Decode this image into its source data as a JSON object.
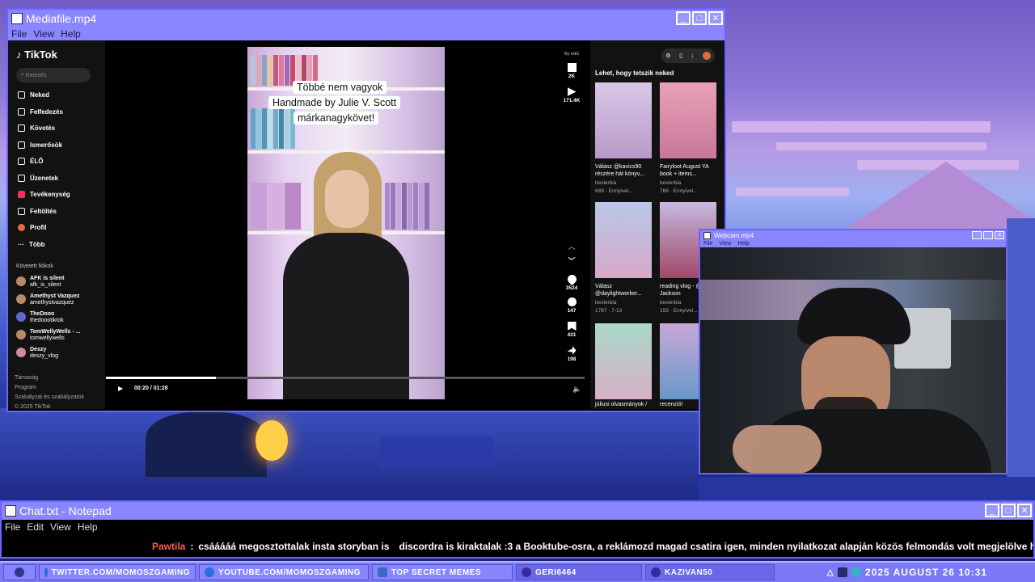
{
  "media_window": {
    "title": "Mediafile.mp4",
    "menu": [
      "File",
      "View",
      "Help"
    ]
  },
  "tiktok": {
    "logo": "TikTok",
    "search_placeholder": "Keresés",
    "nav": [
      "Neked",
      "Felfedezés",
      "Követés",
      "Ismerősök",
      "ÉLŐ",
      "Üzenetek",
      "Tevékenység",
      "Feltöltés",
      "Profil",
      "Több"
    ],
    "followed_heading": "Követett fiókok",
    "followed": [
      {
        "name": "AFK is silent",
        "handle": "afk_is_silent"
      },
      {
        "name": "Amethyst Vazquez",
        "handle": "amethystvazquez"
      },
      {
        "name": "TheDooo",
        "handle": "thedoootiktok"
      },
      {
        "name": "TomWellyWells - ...",
        "handle": "tomwellywells"
      },
      {
        "name": "Deszy",
        "handle": "deszy_vlog"
      }
    ],
    "footer": [
      "Társaság",
      "Program",
      "Szabályzat és szabályzatok",
      "© 2025 TikTok"
    ],
    "caption_lines": [
      "Többé nem vagyok",
      "Handmade by Julie V. Scott",
      "márkanagykövet!"
    ],
    "time": "00:20 / 01:28",
    "progress": 0.23,
    "byline": "By ridG",
    "stats": {
      "a": "2K",
      "b": "171.4K",
      "likes": "3524",
      "comments": "147",
      "saves": "431",
      "shares": "198"
    },
    "recs_heading": "Lehet, hogy tetszik neked",
    "recs": [
      {
        "title": "Válasz @kavics90 részére hát könyv,...",
        "author": "bexlerbia",
        "stats": "669 · Ennyivel..."
      },
      {
        "title": "Fairyloot August YA book + items...",
        "author": "bexlerbia",
        "stats": "768 · Ennyivel..."
      },
      {
        "title": "Válasz @daylightworker...",
        "author": "bexlerbia",
        "stats": "1787 · 7-13"
      },
      {
        "title": "reading vlog - @Holly Jackson",
        "author": "bexlerbia",
        "stats": "159 · Ennyivel..."
      },
      {
        "title": "júliusi olvasmányok /",
        "author": "",
        "stats": ""
      },
      {
        "title": "recenzió!",
        "author": "",
        "stats": ""
      }
    ]
  },
  "webcam_window": {
    "title": "Webcam.mp4",
    "menu": [
      "File",
      "View",
      "Help"
    ]
  },
  "chat_window": {
    "title": "Chat.txt - Notepad",
    "menu": [
      "File",
      "Edit",
      "View",
      "Help"
    ],
    "user": "Pawtila",
    "message": "csááááá  megosztottalak insta storyban is",
    "rest": "discordra is kiraktalak :3   a Booktube-osra, a reklámozd magad csatira   igen, minden nyilatkozat alapján közös felmondás volt megjelölve   hangosabb a videó nálad"
  },
  "taskbar": {
    "items": [
      "TWITTER.COM/MOMOSZGAMING",
      "YOUTUBE.COM/MOMOSZGAMING",
      "TOP SECRET MEMES",
      "GERI6464",
      "KAZIVAN50"
    ],
    "clock": "2025 AUGUST 26  10:31"
  },
  "colors": {
    "accent": "#8a86ff",
    "border": "#6b63ff",
    "username": "#ff5b5b"
  }
}
